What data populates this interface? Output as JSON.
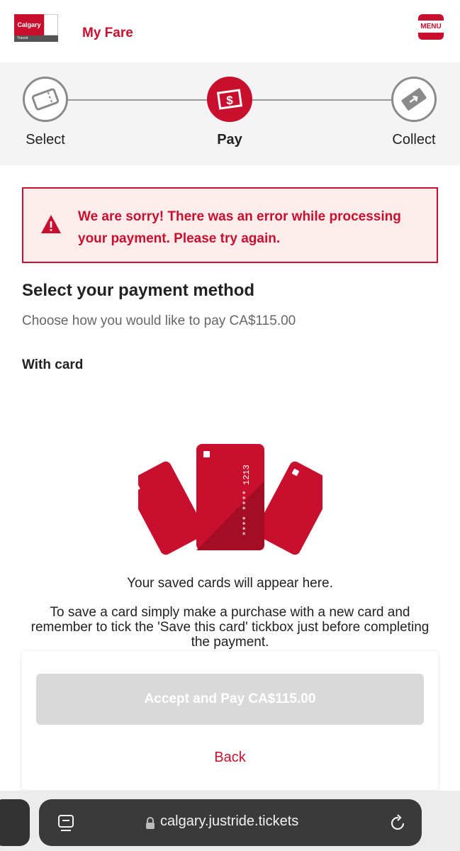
{
  "header": {
    "logo_text": "Calgary",
    "logo_sub": "Transit",
    "app_title": "My Fare",
    "menu_label": "MENU"
  },
  "stepper": {
    "steps": [
      {
        "label": "Select",
        "icon": "ticket-icon",
        "state": "done"
      },
      {
        "label": "Pay",
        "icon": "dollar-bill-icon",
        "state": "active"
      },
      {
        "label": "Collect",
        "icon": "collect-ticket-icon",
        "state": "pending"
      }
    ]
  },
  "error": {
    "icon": "warning-triangle-icon",
    "message": "We are sorry! There was an error while processing your payment. Please try again."
  },
  "payment": {
    "title": "Select your payment method",
    "subtitle": "Choose how you would like to pay CA$115.00",
    "with_card_label": "With card",
    "card_number_masked": "**** **** 1213",
    "empty_title": "Your saved cards will appear here.",
    "empty_hint": "To save a card simply make a purchase with a new card and remember to tick the 'Save this card' tickbox just before completing the payment."
  },
  "actions": {
    "pay_button": "Accept and Pay CA$115.00",
    "back_link": "Back"
  },
  "browser": {
    "url": "calgary.justride.tickets"
  },
  "colors": {
    "brand_red": "#c8102e",
    "error_bg": "#fdecec",
    "disabled_button": "#d9d9d9"
  }
}
